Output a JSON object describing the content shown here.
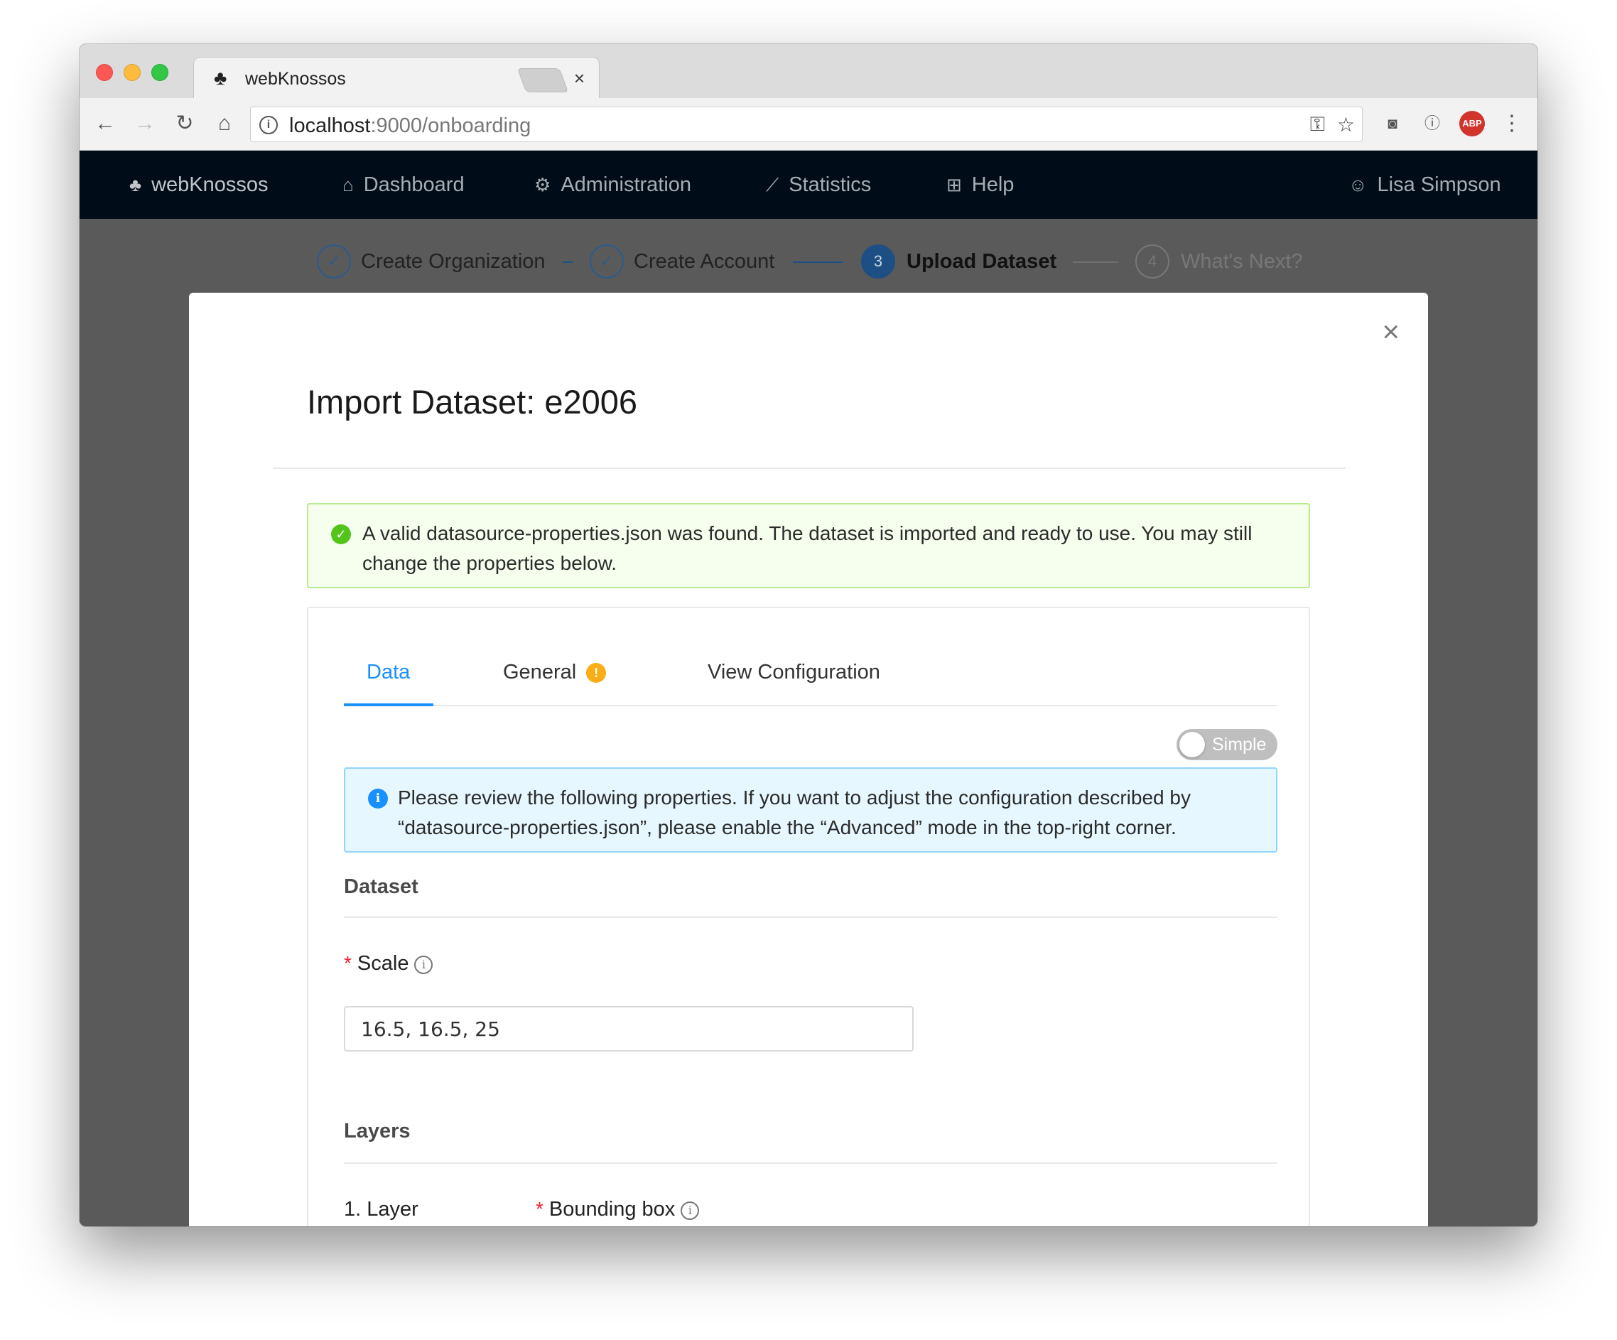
{
  "browser": {
    "tab_title": "webKnossos",
    "tab_close": "×",
    "url_host": "localhost",
    "url_rest": ":9000/onboarding"
  },
  "nav": {
    "brand": "webKnossos",
    "items": [
      {
        "label": "Dashboard",
        "icon": "home-icon"
      },
      {
        "label": "Administration",
        "icon": "gear-icon"
      },
      {
        "label": "Statistics",
        "icon": "line-chart-icon"
      },
      {
        "label": "Help",
        "icon": "medicine-box-icon"
      }
    ],
    "user": "Lisa Simpson"
  },
  "steps": [
    {
      "label": "Create Organization",
      "status": "finish"
    },
    {
      "label": "Create Account",
      "status": "finish"
    },
    {
      "label": "Upload Dataset",
      "status": "process",
      "number": "3"
    },
    {
      "label": "What's Next?",
      "status": "wait",
      "number": "4"
    }
  ],
  "modal": {
    "title": "Import Dataset: e2006",
    "close": "×",
    "success_message": "A valid datasource-properties.json was found. The dataset is imported and ready to use. You may still change the properties below.",
    "tabs": [
      "Data",
      "General",
      "View Configuration"
    ],
    "active_tab": "Data",
    "general_warning": "!",
    "mode_switch_label": "Simple",
    "info_message": "Please review the following properties. If you want to adjust the configuration described by “datasource-properties.json”, please enable the “Advanced” mode in the top-right corner.",
    "dataset_section": "Dataset",
    "scale_label": "Scale",
    "scale_value": "16.5, 16.5, 25",
    "layers_section": "Layers",
    "layer_name": "1. Layer",
    "bounding_box_label": "Bounding box",
    "required_mark": "*",
    "info_glyph": "i"
  },
  "colors": {
    "header_bg": "#000c17",
    "primary": "#1890ff",
    "success": "#52c41a",
    "warning": "#faad14",
    "step_active": "#1d4f85"
  }
}
